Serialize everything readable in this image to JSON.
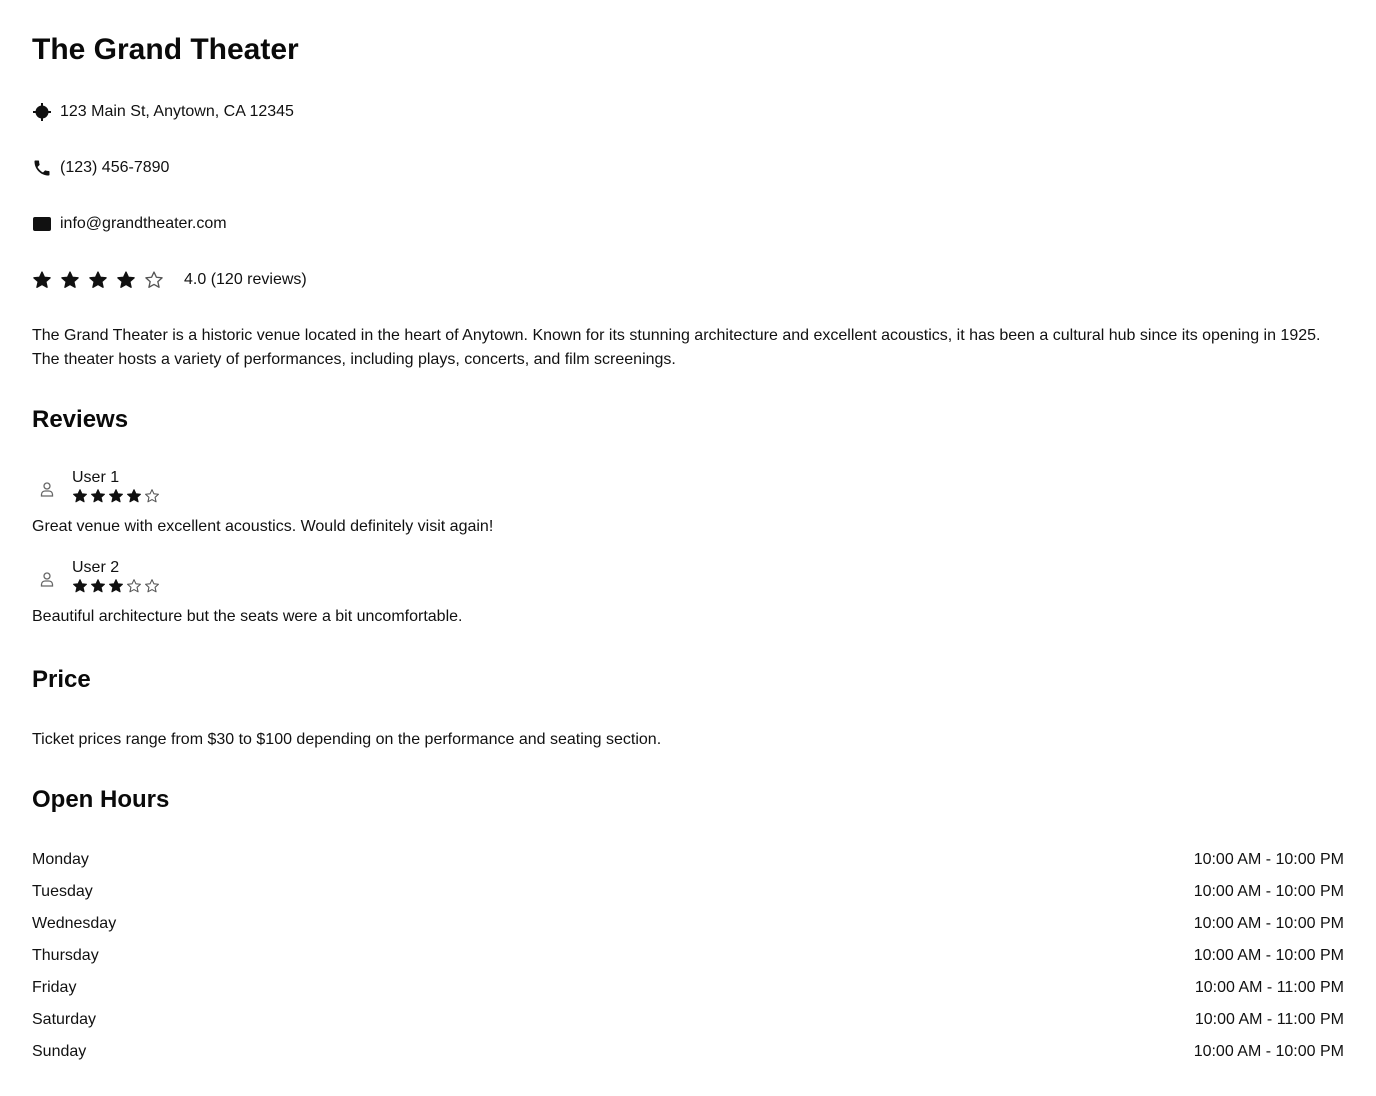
{
  "venue": {
    "name": "The Grand Theater",
    "address": "123 Main St, Anytown, CA 12345",
    "phone": "(123) 456-7890",
    "email": "info@grandtheater.com",
    "rating": 4,
    "rating_text": "4.0 (120 reviews)",
    "description": "The Grand Theater is a historic venue located in the heart of Anytown. Known for its stunning architecture and excellent acoustics, it has been a cultural hub since its opening in 1925. The theater hosts a variety of performances, including plays, concerts, and film screenings."
  },
  "icons": {
    "address": "location-target-icon",
    "phone": "phone-icon",
    "email": "envelope-icon",
    "avatar": "user-icon",
    "star_filled": "star-filled-icon",
    "star_empty": "star-outline-icon"
  },
  "reviews": {
    "heading": "Reviews",
    "items": [
      {
        "user": "User 1",
        "rating": 4,
        "text": "Great venue with excellent acoustics. Would definitely visit again!"
      },
      {
        "user": "User 2",
        "rating": 3,
        "text": "Beautiful architecture but the seats were a bit uncomfortable."
      }
    ]
  },
  "price": {
    "heading": "Price",
    "text": "Ticket prices range from $30 to $100 depending on the performance and seating section."
  },
  "hours": {
    "heading": "Open Hours",
    "rows": [
      {
        "day": "Monday",
        "time": "10:00 AM - 10:00 PM"
      },
      {
        "day": "Tuesday",
        "time": "10:00 AM - 10:00 PM"
      },
      {
        "day": "Wednesday",
        "time": "10:00 AM - 10:00 PM"
      },
      {
        "day": "Thursday",
        "time": "10:00 AM - 10:00 PM"
      },
      {
        "day": "Friday",
        "time": "10:00 AM - 11:00 PM"
      },
      {
        "day": "Saturday",
        "time": "10:00 AM - 11:00 PM"
      },
      {
        "day": "Sunday",
        "time": "10:00 AM - 10:00 PM"
      }
    ]
  },
  "colors": {
    "text": "#111111",
    "star_filled": "#111111",
    "star_empty": "#555555",
    "avatar": "#666666"
  }
}
